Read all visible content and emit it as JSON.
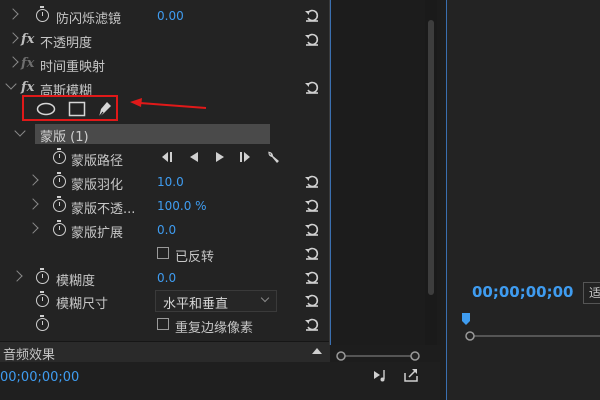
{
  "effects_panel": {
    "rows": {
      "anti_flicker": {
        "label": "防闪烁滤镜",
        "value": "0.00"
      },
      "opacity": {
        "label": "不透明度"
      },
      "time_remap": {
        "label": "时间重映射"
      },
      "gaussian_blur": {
        "label": "高斯模糊"
      },
      "mask": {
        "label": "蒙版 (1)"
      },
      "mask_path": {
        "label": "蒙版路径"
      },
      "mask_feather": {
        "label": "蒙版羽化",
        "value": "10.0"
      },
      "mask_opacity": {
        "label": "蒙版不透...",
        "value": "100.0 %"
      },
      "mask_expansion": {
        "label": "蒙版扩展",
        "value": "0.0"
      },
      "inverted": {
        "label": "已反转"
      },
      "blurriness": {
        "label": "模糊度",
        "value": "0.0"
      },
      "blur_dimensions": {
        "label": "模糊尺寸",
        "value": "水平和垂直"
      },
      "repeat_edge": {
        "label": "重复边缘像素"
      }
    },
    "audio_effects_label": "音频效果",
    "timecode": "00;00;00;00"
  },
  "program_monitor": {
    "timecode": "00;00;00;00",
    "fit_label": "适"
  },
  "icons": {
    "fx": "fx",
    "stopwatch": "stopwatch-icon",
    "reset": "reset-icon",
    "ellipse_mask": "ellipse-mask-icon",
    "rect_mask": "rectangle-mask-icon",
    "pen_mask": "pen-mask-icon",
    "track_back": "track-selected-backward-icon",
    "step_back": "step-backward-icon",
    "step_fwd": "step-forward-icon",
    "track_fwd": "track-selected-forward-icon",
    "wrench": "wrench-icon"
  },
  "colors": {
    "accent": "#3f9cf0",
    "highlight": "#e01919",
    "panel_bg": "#232323"
  }
}
